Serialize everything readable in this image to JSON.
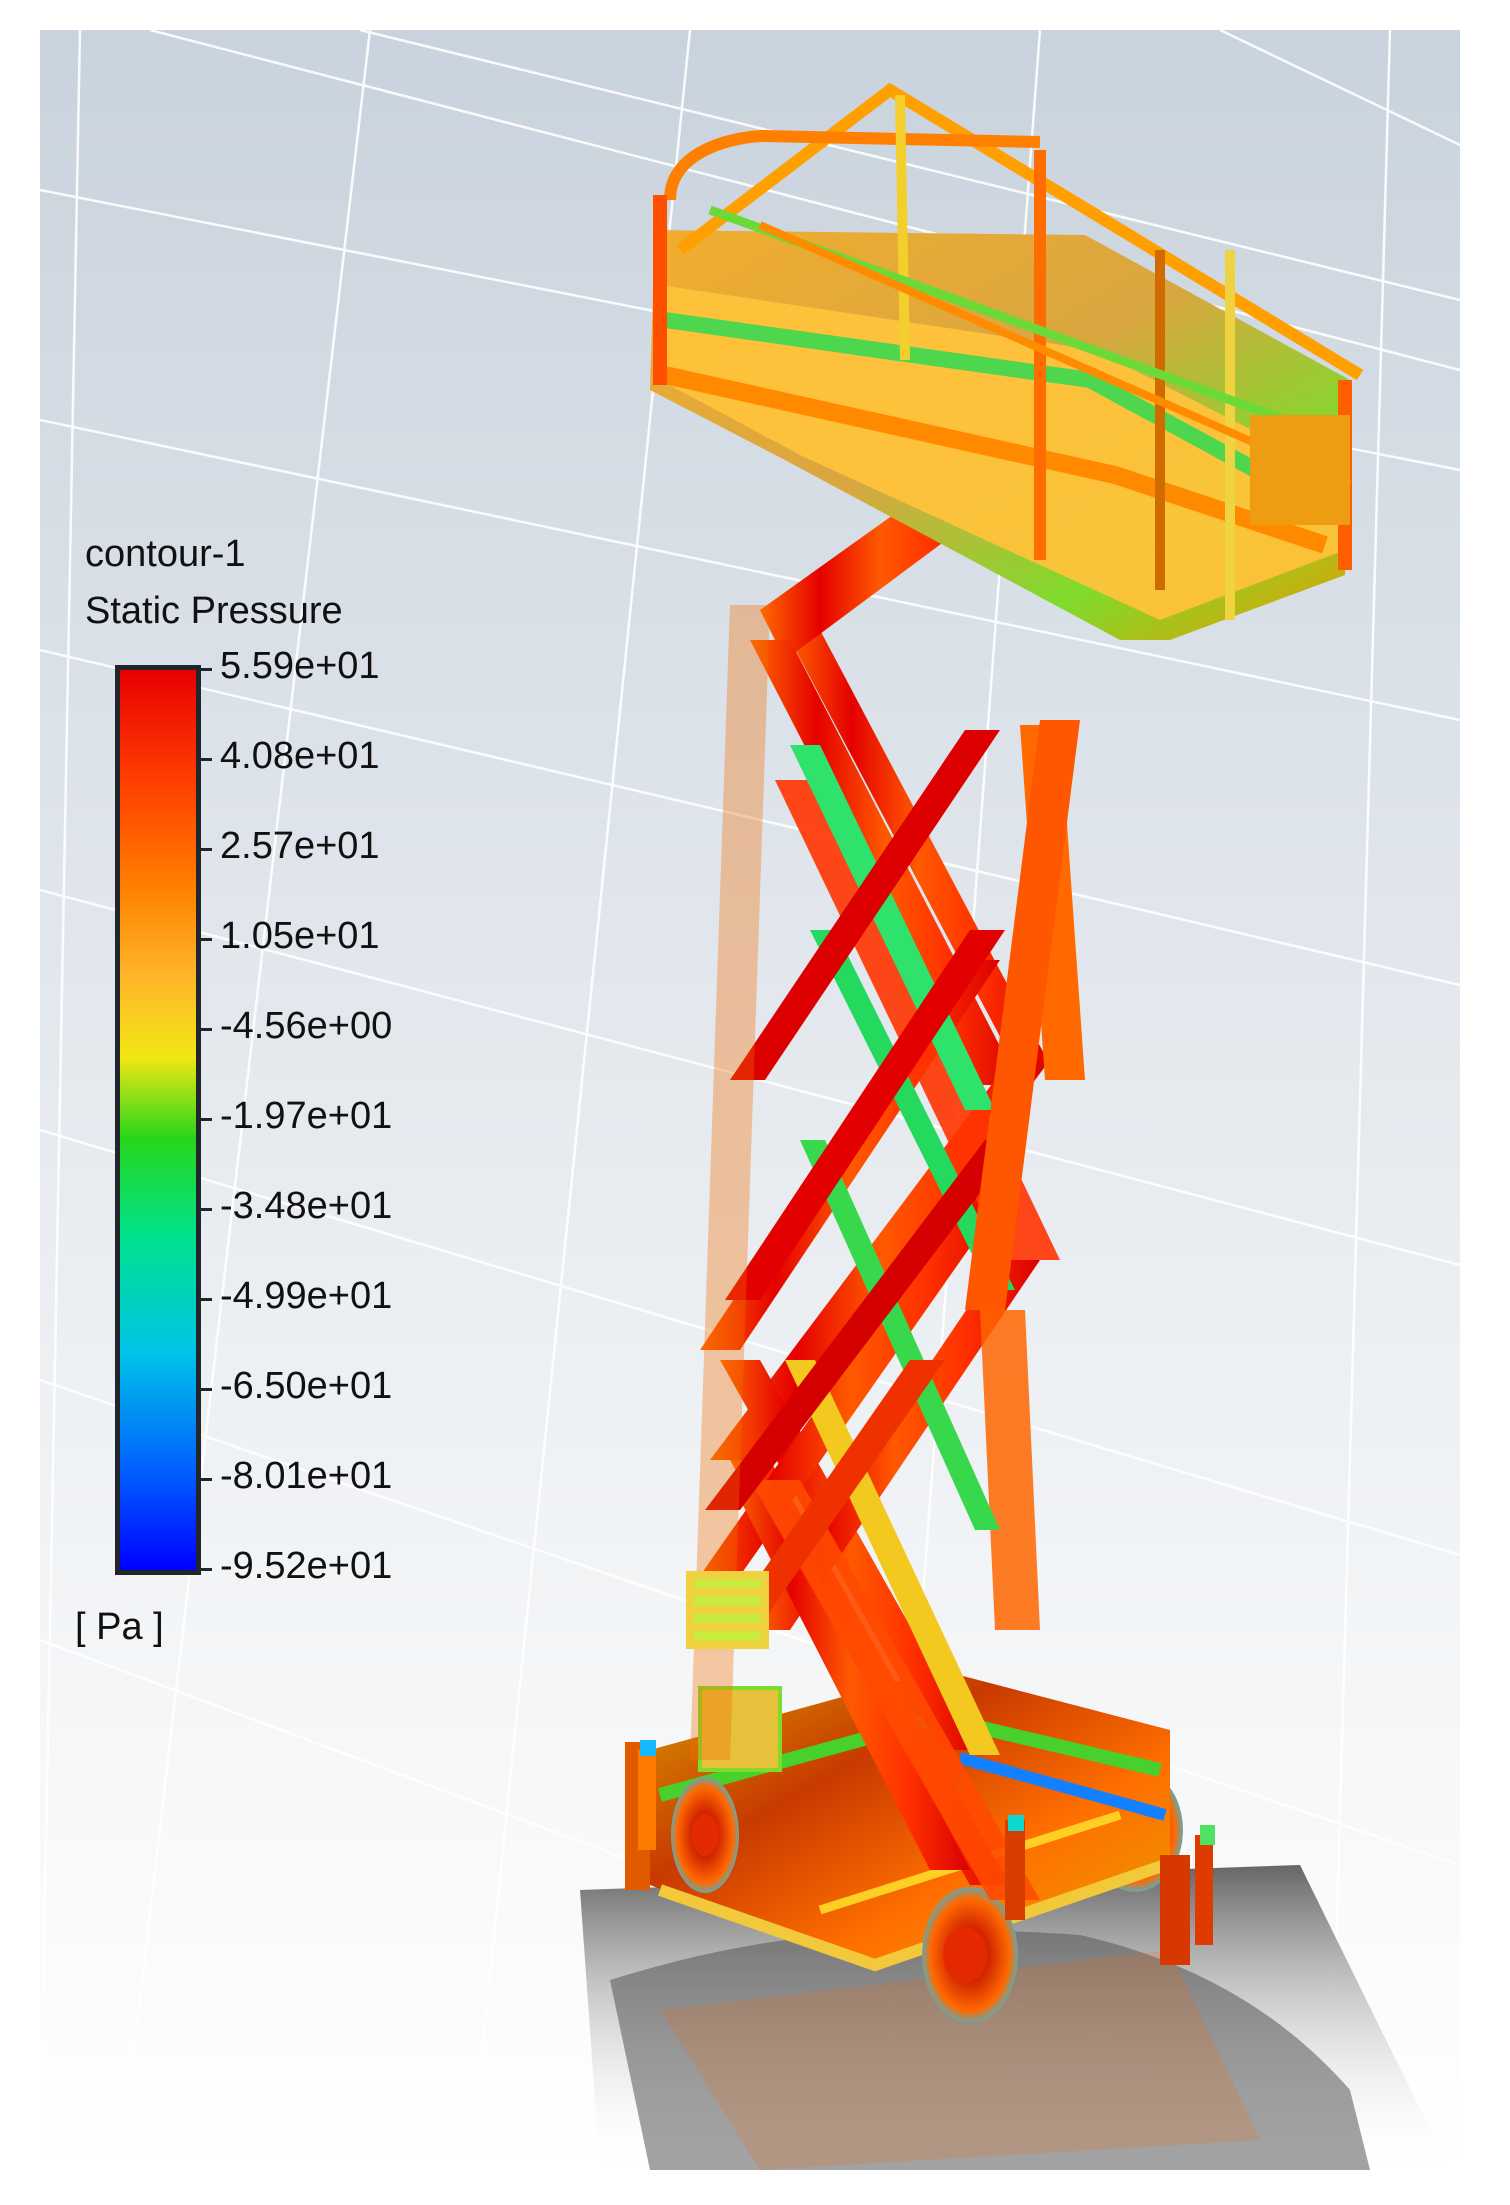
{
  "legend": {
    "title": "contour-1",
    "subtitle": "Static Pressure",
    "unit": "[ Pa ]",
    "colormap": [
      "#0000ff",
      "#0072ff",
      "#00c8ff",
      "#00e7b0",
      "#22d73a",
      "#b8ea0c",
      "#ffd21a",
      "#ffa51f",
      "#ff5a00",
      "#e80000"
    ],
    "tick_values": [
      "5.59e+01",
      "4.08e+01",
      "2.57e+01",
      "1.05e+01",
      "-4.56e+00",
      "-1.97e+01",
      "-3.48e+01",
      "-4.99e+01",
      "-6.50e+01",
      "-8.01e+01",
      "-9.52e+01"
    ]
  },
  "scene": {
    "object": "scissor-lift",
    "background_top": "#c9d3dd",
    "background_bottom": "#ffffff",
    "grid_color": "#ffffff"
  }
}
